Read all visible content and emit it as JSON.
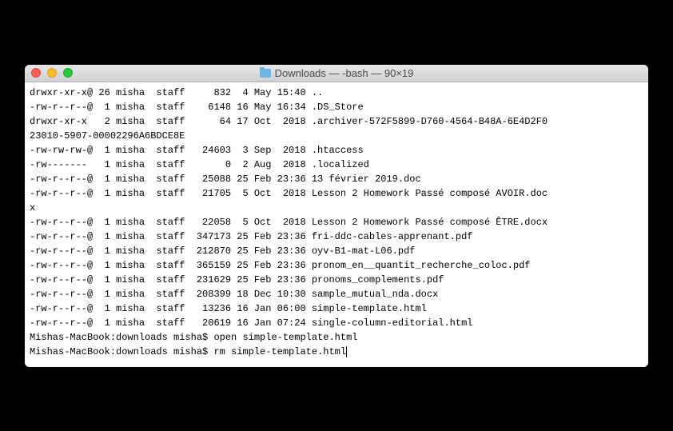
{
  "window": {
    "title": "Downloads — -bash — 90×19"
  },
  "listing": [
    "drwxr-xr-x@ 26 misha  staff     832  4 May 15:40 ..",
    "-rw-r--r--@  1 misha  staff    6148 16 May 16:34 .DS_Store",
    "drwxr-xr-x   2 misha  staff      64 17 Oct  2018 .archiver-572F5899-D760-4564-B48A-6E4D2F0",
    "23010-5907-00002296A6BDCE8E",
    "-rw-rw-rw-@  1 misha  staff   24603  3 Sep  2018 .htaccess",
    "-rw-------   1 misha  staff       0  2 Aug  2018 .localized",
    "-rw-r--r--@  1 misha  staff   25088 25 Feb 23:36 13 février 2019.doc",
    "-rw-r--r--@  1 misha  staff   21705  5 Oct  2018 Lesson 2 Homework Passé composé AVOIR.doc",
    "x",
    "-rw-r--r--@  1 misha  staff   22058  5 Oct  2018 Lesson 2 Homework Passé composé ÊTRE.docx",
    "-rw-r--r--@  1 misha  staff  347173 25 Feb 23:36 fri-ddc-cables-apprenant.pdf",
    "-rw-r--r--@  1 misha  staff  212870 25 Feb 23:36 oyv-B1-mat-L06.pdf",
    "-rw-r--r--@  1 misha  staff  365159 25 Feb 23:36 pronom_en__quantit_recherche_coloc.pdf",
    "-rw-r--r--@  1 misha  staff  231629 25 Feb 23:36 pronoms_complements.pdf",
    "-rw-r--r--@  1 misha  staff  208399 18 Dec 10:30 sample_mutual_nda.docx",
    "-rw-r--r--@  1 misha  staff   13236 16 Jan 06:00 simple-template.html",
    "-rw-r--r--@  1 misha  staff   20619 16 Jan 07:24 single-column-editorial.html"
  ],
  "prompts": [
    {
      "prompt": "Mishas-MacBook:downloads misha$ ",
      "command": "open simple-template.html"
    },
    {
      "prompt": "Mishas-MacBook:downloads misha$ ",
      "command": "rm simple-template.html"
    }
  ]
}
